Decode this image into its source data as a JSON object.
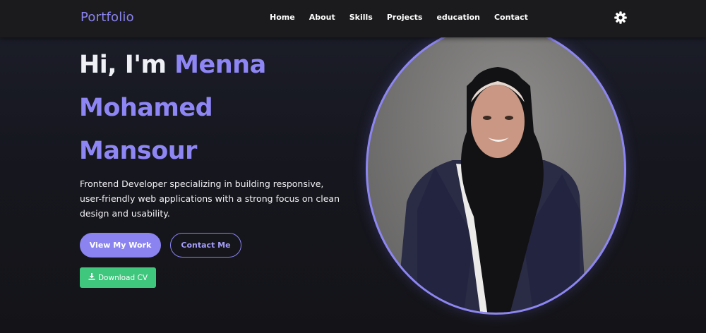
{
  "navbar": {
    "brand": "Portfolio",
    "links": [
      "Home",
      "About",
      "Skills",
      "Projects",
      "education",
      "Contact"
    ],
    "theme_icon": "gear-icon"
  },
  "hero": {
    "greeting": "Hi, I'm",
    "name_first": "Menna",
    "name_middle": "Mohamed",
    "name_last": "Mansour",
    "description": "Frontend Developer specializing in building responsive, user-friendly web applications with a strong focus on clean design and usability.",
    "primary_button": "View My Work",
    "secondary_button": "Contact Me",
    "download_button": "Download CV",
    "download_icon": "download-icon"
  },
  "colors": {
    "accent": "#8b84f0",
    "download_green": "#3fc77d",
    "navbar_bg": "#1b1b1d",
    "page_bg": "#16171f"
  }
}
